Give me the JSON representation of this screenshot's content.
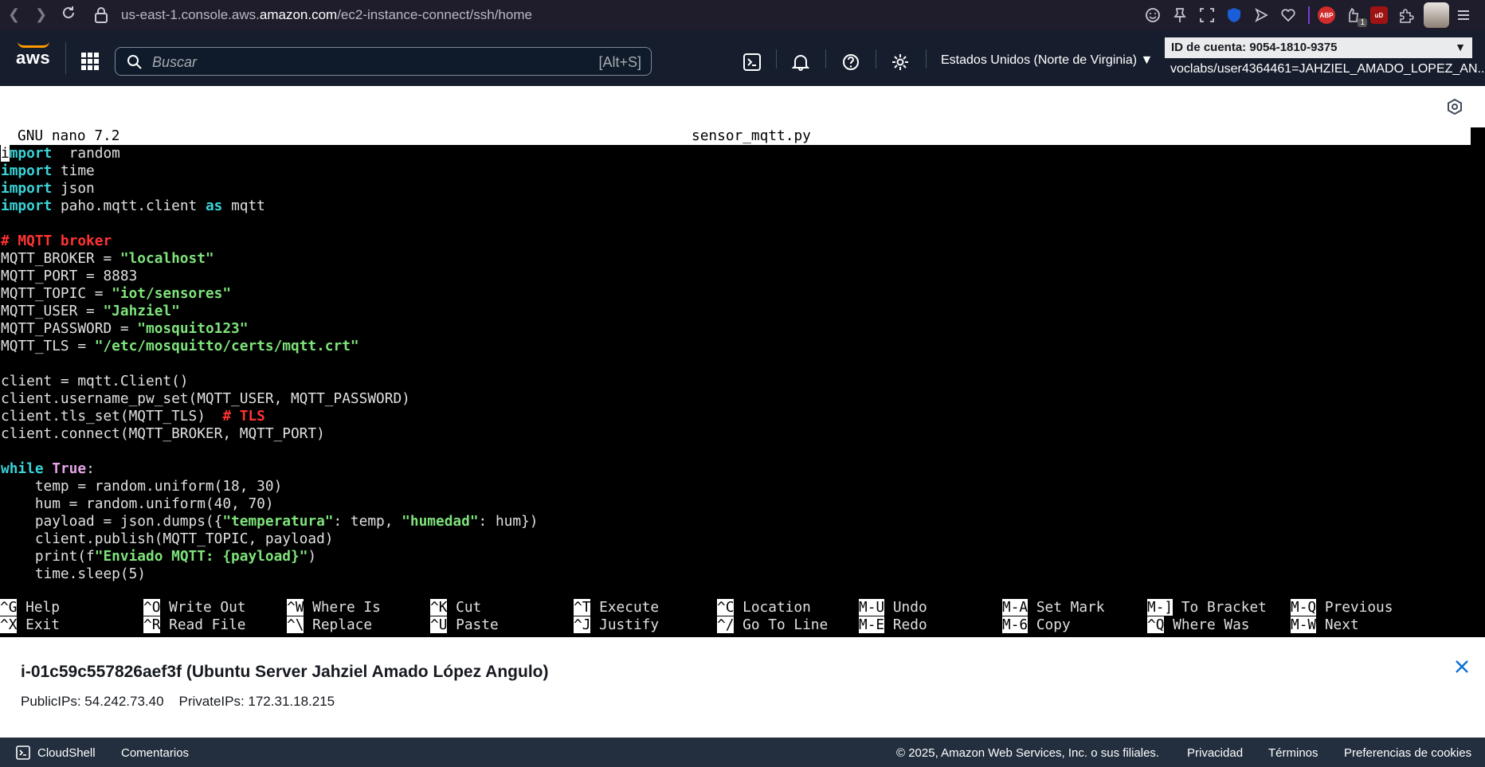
{
  "browser": {
    "url_prefix": "us-east-1.console.aws.",
    "url_domain": "amazon.com",
    "url_path": "/ec2-instance-connect/ssh/home",
    "extensions": [
      "smiley-icon",
      "pin-icon",
      "screenshot-icon",
      "shield-icon",
      "send-icon",
      "heart-icon",
      "adblock-icon",
      "hand-icon",
      "ublock-icon",
      "puzzle-icon",
      "menu-icon"
    ],
    "abp_label": "ABP",
    "hand_badge": "1",
    "ublock_label": "uD"
  },
  "aws": {
    "logo": "aws",
    "search_placeholder": "Buscar",
    "search_shortcut": "[Alt+S]",
    "region": "Estados Unidos (Norte de Virginia)",
    "account_id": "ID de cuenta: 9054-1810-9375",
    "account_user": "voclabs/user4364461=JAHZIEL_AMADO_LOPEZ_AN..."
  },
  "nano": {
    "version": "GNU nano 7.2",
    "filename": "sensor_mqtt.py",
    "shortcuts_row1": [
      {
        "key": "^G",
        "label": "Help"
      },
      {
        "key": "^O",
        "label": "Write Out"
      },
      {
        "key": "^W",
        "label": "Where Is"
      },
      {
        "key": "^K",
        "label": "Cut"
      },
      {
        "key": "^T",
        "label": "Execute"
      },
      {
        "key": "^C",
        "label": "Location"
      },
      {
        "key": "M-U",
        "label": "Undo"
      },
      {
        "key": "M-A",
        "label": "Set Mark"
      },
      {
        "key": "M-]",
        "label": "To Bracket"
      },
      {
        "key": "M-Q",
        "label": "Previous"
      }
    ],
    "shortcuts_row2": [
      {
        "key": "^X",
        "label": "Exit"
      },
      {
        "key": "^R",
        "label": "Read File"
      },
      {
        "key": "^\\",
        "label": "Replace"
      },
      {
        "key": "^U",
        "label": "Paste"
      },
      {
        "key": "^J",
        "label": "Justify"
      },
      {
        "key": "^/",
        "label": "Go To Line"
      },
      {
        "key": "M-E",
        "label": "Redo"
      },
      {
        "key": "M-6",
        "label": "Copy"
      },
      {
        "key": "^Q",
        "label": "Where Was"
      },
      {
        "key": "M-W",
        "label": "Next"
      }
    ],
    "code": [
      [
        [
          "cursor",
          "i"
        ],
        [
          "kw",
          "mport"
        ],
        [
          "",
          "  random"
        ]
      ],
      [
        [
          "kw",
          "import"
        ],
        [
          "",
          " time"
        ]
      ],
      [
        [
          "kw",
          "import"
        ],
        [
          "",
          " json"
        ]
      ],
      [
        [
          "kw",
          "import"
        ],
        [
          "",
          " paho.mqtt.client "
        ],
        [
          "kw",
          "as"
        ],
        [
          "",
          " mqtt"
        ]
      ],
      [],
      [
        [
          "cmt",
          "# MQTT broker"
        ]
      ],
      [
        [
          "",
          "MQTT_BROKER = "
        ],
        [
          "str",
          "\"localhost\""
        ]
      ],
      [
        [
          "",
          "MQTT_PORT = 8883"
        ]
      ],
      [
        [
          "",
          "MQTT_TOPIC = "
        ],
        [
          "str",
          "\"iot/sensores\""
        ]
      ],
      [
        [
          "",
          "MQTT_USER = "
        ],
        [
          "str",
          "\"Jahziel\""
        ]
      ],
      [
        [
          "",
          "MQTT_PASSWORD = "
        ],
        [
          "str",
          "\"mosquito123\""
        ]
      ],
      [
        [
          "",
          "MQTT_TLS = "
        ],
        [
          "str",
          "\"/etc/mosquitto/certs/mqtt.crt\""
        ]
      ],
      [],
      [
        [
          "",
          "client = mqtt.Client()"
        ]
      ],
      [
        [
          "",
          "client.username_pw_set(MQTT_USER, MQTT_PASSWORD)"
        ]
      ],
      [
        [
          "",
          "client.tls_set(MQTT_TLS)  "
        ],
        [
          "cmt",
          "# TLS"
        ]
      ],
      [
        [
          "",
          "client.connect(MQTT_BROKER, MQTT_PORT)"
        ]
      ],
      [],
      [
        [
          "kw",
          "while"
        ],
        [
          "",
          " "
        ],
        [
          "bool",
          "True"
        ],
        [
          "",
          ":"
        ]
      ],
      [
        [
          "",
          "    temp = random.uniform(18, 30)"
        ]
      ],
      [
        [
          "",
          "    hum = random.uniform(40, 70)"
        ]
      ],
      [
        [
          "",
          "    payload = json.dumps({"
        ],
        [
          "str",
          "\"temperatura\""
        ],
        [
          "",
          ": temp, "
        ],
        [
          "str",
          "\"humedad\""
        ],
        [
          "",
          ": hum})"
        ]
      ],
      [
        [
          "",
          "    client.publish(MQTT_TOPIC, payload)"
        ]
      ],
      [
        [
          "",
          "    print(f"
        ],
        [
          "str",
          "\"Enviado MQTT: {payload}\""
        ],
        [
          "",
          ")"
        ]
      ],
      [
        [
          "",
          "    time.sleep(5)"
        ]
      ]
    ]
  },
  "instance": {
    "title": "i-01c59c557826aef3f (Ubuntu Server Jahziel Amado López Angulo)",
    "public_ips_label": "PublicIPs: 54.242.73.40",
    "private_ips_label": "PrivateIPs: 172.31.18.215"
  },
  "footer": {
    "cloudshell": "CloudShell",
    "comments": "Comentarios",
    "copyright": "© 2025, Amazon Web Services, Inc. o sus filiales.",
    "privacy": "Privacidad",
    "terms": "Términos",
    "cookies": "Preferencias de cookies"
  }
}
